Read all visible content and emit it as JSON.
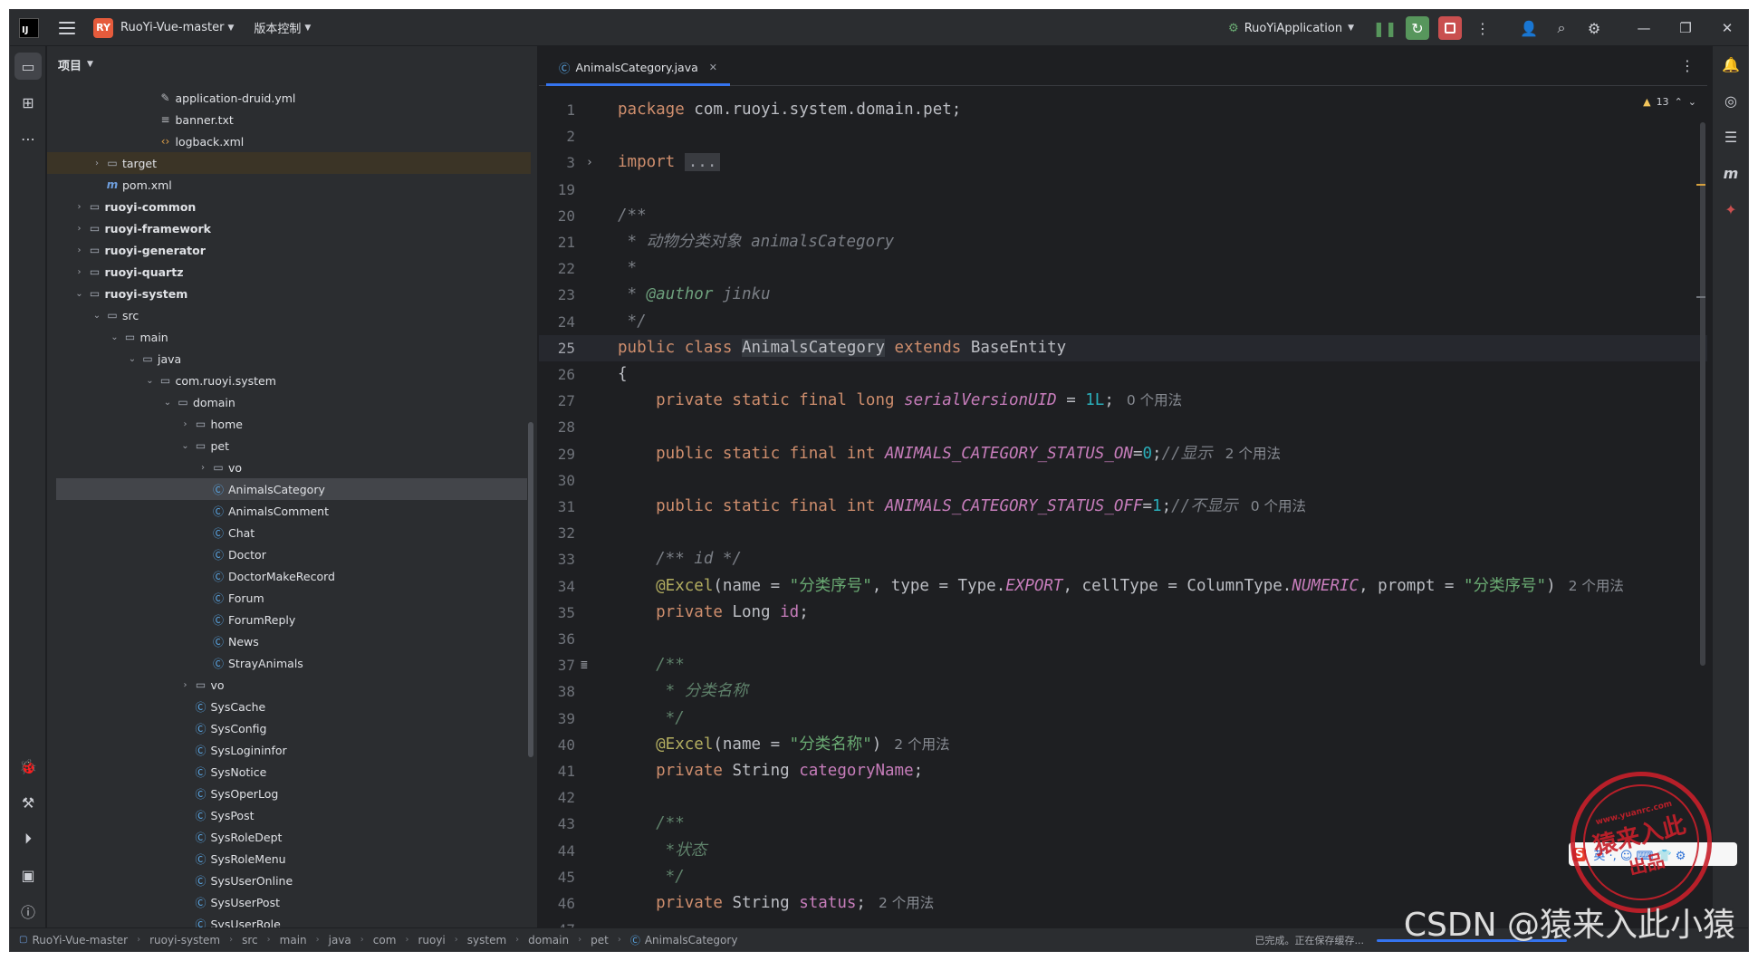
{
  "titlebar": {
    "project_badge": "RY",
    "project_name": "RuoYi-Vue-master",
    "vcs_label": "版本控制",
    "run_config": "RuoYiApplication"
  },
  "project_panel": {
    "title": "项目",
    "tree": [
      {
        "depth": 6,
        "icon": "yml-file-icon",
        "label": "application-druid.yml",
        "arrow": ""
      },
      {
        "depth": 6,
        "icon": "text-file-icon",
        "label": "banner.txt",
        "arrow": ""
      },
      {
        "depth": 6,
        "icon": "xml-file-icon",
        "label": "logback.xml",
        "arrow": ""
      },
      {
        "depth": 3,
        "icon": "folder-icon",
        "label": "target",
        "arrow": "collapsed",
        "highlight": true
      },
      {
        "depth": 3,
        "icon": "maven-icon",
        "label": "pom.xml",
        "arrow": ""
      },
      {
        "depth": 2,
        "icon": "module-folder-icon",
        "label": "ruoyi-common",
        "arrow": "collapsed",
        "bold": true
      },
      {
        "depth": 2,
        "icon": "module-folder-icon",
        "label": "ruoyi-framework",
        "arrow": "collapsed",
        "bold": true
      },
      {
        "depth": 2,
        "icon": "module-folder-icon",
        "label": "ruoyi-generator",
        "arrow": "collapsed",
        "bold": true
      },
      {
        "depth": 2,
        "icon": "module-folder-icon",
        "label": "ruoyi-quartz",
        "arrow": "collapsed",
        "bold": true
      },
      {
        "depth": 2,
        "icon": "module-folder-icon",
        "label": "ruoyi-system",
        "arrow": "expanded",
        "bold": true
      },
      {
        "depth": 3,
        "icon": "folder-icon",
        "label": "src",
        "arrow": "expanded"
      },
      {
        "depth": 4,
        "icon": "folder-icon",
        "label": "main",
        "arrow": "expanded"
      },
      {
        "depth": 5,
        "icon": "source-folder-icon",
        "label": "java",
        "arrow": "expanded"
      },
      {
        "depth": 6,
        "icon": "package-icon",
        "label": "com.ruoyi.system",
        "arrow": "expanded"
      },
      {
        "depth": 7,
        "icon": "package-icon",
        "label": "domain",
        "arrow": "expanded"
      },
      {
        "depth": 8,
        "icon": "package-icon",
        "label": "home",
        "arrow": "collapsed"
      },
      {
        "depth": 8,
        "icon": "package-icon",
        "label": "pet",
        "arrow": "expanded"
      },
      {
        "depth": 9,
        "icon": "package-icon",
        "label": "vo",
        "arrow": "collapsed"
      },
      {
        "depth": 9,
        "icon": "class-icon",
        "label": "AnimalsCategory",
        "arrow": "",
        "selected": true
      },
      {
        "depth": 9,
        "icon": "class-icon",
        "label": "AnimalsComment",
        "arrow": ""
      },
      {
        "depth": 9,
        "icon": "class-icon",
        "label": "Chat",
        "arrow": ""
      },
      {
        "depth": 9,
        "icon": "class-icon",
        "label": "Doctor",
        "arrow": ""
      },
      {
        "depth": 9,
        "icon": "class-icon",
        "label": "DoctorMakeRecord",
        "arrow": ""
      },
      {
        "depth": 9,
        "icon": "class-icon",
        "label": "Forum",
        "arrow": ""
      },
      {
        "depth": 9,
        "icon": "class-icon",
        "label": "ForumReply",
        "arrow": ""
      },
      {
        "depth": 9,
        "icon": "class-icon",
        "label": "News",
        "arrow": ""
      },
      {
        "depth": 9,
        "icon": "class-icon",
        "label": "StrayAnimals",
        "arrow": ""
      },
      {
        "depth": 8,
        "icon": "package-icon",
        "label": "vo",
        "arrow": "collapsed"
      },
      {
        "depth": 8,
        "icon": "class-icon",
        "label": "SysCache",
        "arrow": ""
      },
      {
        "depth": 8,
        "icon": "class-icon",
        "label": "SysConfig",
        "arrow": ""
      },
      {
        "depth": 8,
        "icon": "class-icon",
        "label": "SysLogininfor",
        "arrow": ""
      },
      {
        "depth": 8,
        "icon": "class-icon",
        "label": "SysNotice",
        "arrow": ""
      },
      {
        "depth": 8,
        "icon": "class-icon",
        "label": "SysOperLog",
        "arrow": ""
      },
      {
        "depth": 8,
        "icon": "class-icon",
        "label": "SysPost",
        "arrow": ""
      },
      {
        "depth": 8,
        "icon": "class-icon",
        "label": "SysRoleDept",
        "arrow": ""
      },
      {
        "depth": 8,
        "icon": "class-icon",
        "label": "SysRoleMenu",
        "arrow": ""
      },
      {
        "depth": 8,
        "icon": "class-icon",
        "label": "SysUserOnline",
        "arrow": ""
      },
      {
        "depth": 8,
        "icon": "class-icon",
        "label": "SysUserPost",
        "arrow": ""
      },
      {
        "depth": 8,
        "icon": "class-icon",
        "label": "SysUserRole",
        "arrow": ""
      }
    ]
  },
  "editor": {
    "tab_label": "AnimalsCategory.java",
    "warning_count": "13",
    "lines": [
      {
        "n": "1",
        "segs": [
          [
            "kw",
            "package "
          ],
          [
            "",
            "com.ruoyi.system.domain.pet;"
          ]
        ]
      },
      {
        "n": "2",
        "segs": []
      },
      {
        "n": "3",
        "fold": true,
        "segs": [
          [
            "kw",
            "import "
          ],
          [
            "fold",
            "..."
          ]
        ]
      },
      {
        "n": "19",
        "segs": []
      },
      {
        "n": "20",
        "segs": [
          [
            "cm",
            "/**"
          ]
        ]
      },
      {
        "n": "21",
        "segs": [
          [
            "cm",
            " * 动物分类对象 animalsCategory"
          ]
        ]
      },
      {
        "n": "22",
        "segs": [
          [
            "cm",
            " *"
          ]
        ]
      },
      {
        "n": "23",
        "segs": [
          [
            "cm",
            " * "
          ],
          [
            "cmtag",
            "@author"
          ],
          [
            "cm",
            " jinku"
          ]
        ]
      },
      {
        "n": "24",
        "segs": [
          [
            "cm",
            " */"
          ]
        ]
      },
      {
        "n": "25",
        "current": true,
        "segs": [
          [
            "kw",
            "public class "
          ],
          [
            "caretw",
            "AnimalsCategory"
          ],
          [
            "kw",
            " extends "
          ],
          [
            "",
            "BaseEntity"
          ]
        ]
      },
      {
        "n": "26",
        "segs": [
          [
            "",
            "{"
          ]
        ]
      },
      {
        "n": "27",
        "segs": [
          [
            "kw",
            "    private static final long "
          ],
          [
            "ifld",
            "serialVersionUID"
          ],
          [
            "",
            " = "
          ],
          [
            "num",
            "1L"
          ],
          [
            "",
            ";"
          ],
          [
            "hint",
            "0 个用法"
          ]
        ]
      },
      {
        "n": "28",
        "segs": []
      },
      {
        "n": "29",
        "segs": [
          [
            "kw",
            "    public static final int "
          ],
          [
            "ifld",
            "ANIMALS_CATEGORY_STATUS_ON"
          ],
          [
            "",
            "="
          ],
          [
            "num",
            "0"
          ],
          [
            "",
            ";"
          ],
          [
            "cm",
            "//显示"
          ],
          [
            "hint",
            "2 个用法"
          ]
        ]
      },
      {
        "n": "30",
        "segs": []
      },
      {
        "n": "31",
        "segs": [
          [
            "kw",
            "    public static final int "
          ],
          [
            "ifld",
            "ANIMALS_CATEGORY_STATUS_OFF"
          ],
          [
            "",
            "="
          ],
          [
            "num",
            "1"
          ],
          [
            "",
            ";"
          ],
          [
            "cm",
            "//不显示"
          ],
          [
            "hint",
            "0 个用法"
          ]
        ]
      },
      {
        "n": "32",
        "segs": []
      },
      {
        "n": "33",
        "segs": [
          [
            "cm",
            "    /** id */"
          ]
        ]
      },
      {
        "n": "34",
        "segs": [
          [
            "ann",
            "    @Excel"
          ],
          [
            "",
            "(name = "
          ],
          [
            "st",
            "\"分类序号\""
          ],
          [
            "",
            ", type = Type."
          ],
          [
            "ifld",
            "EXPORT"
          ],
          [
            "",
            ", cellType = ColumnType."
          ],
          [
            "ifld",
            "NUMERIC"
          ],
          [
            "",
            ", prompt = "
          ],
          [
            "st",
            "\"分类序号\""
          ],
          [
            "",
            ")"
          ],
          [
            "hint",
            "2 个用法"
          ]
        ]
      },
      {
        "n": "35",
        "segs": [
          [
            "kw",
            "    private "
          ],
          [
            "",
            "Long "
          ],
          [
            "fld",
            "id"
          ],
          [
            "",
            ";"
          ]
        ]
      },
      {
        "n": "36",
        "segs": []
      },
      {
        "n": "37",
        "doc": true,
        "segs": [
          [
            "cmz",
            "    /**"
          ]
        ]
      },
      {
        "n": "38",
        "segs": [
          [
            "cmz",
            "     * 分类名称"
          ]
        ]
      },
      {
        "n": "39",
        "segs": [
          [
            "cmz",
            "     */"
          ]
        ]
      },
      {
        "n": "40",
        "segs": [
          [
            "ann",
            "    @Excel"
          ],
          [
            "",
            "(name = "
          ],
          [
            "st",
            "\"分类名称\""
          ],
          [
            "",
            ")"
          ],
          [
            "hint",
            "2 个用法"
          ]
        ]
      },
      {
        "n": "41",
        "segs": [
          [
            "kw",
            "    private "
          ],
          [
            "",
            "String "
          ],
          [
            "fld",
            "categoryName"
          ],
          [
            "",
            ";"
          ]
        ]
      },
      {
        "n": "42",
        "segs": []
      },
      {
        "n": "43",
        "segs": [
          [
            "cmz",
            "    /**"
          ]
        ]
      },
      {
        "n": "44",
        "segs": [
          [
            "cmz",
            "     *状态"
          ]
        ]
      },
      {
        "n": "45",
        "segs": [
          [
            "cmz",
            "     */"
          ]
        ]
      },
      {
        "n": "46",
        "segs": [
          [
            "kw",
            "    private "
          ],
          [
            "",
            "String "
          ],
          [
            "fld",
            "status"
          ],
          [
            "",
            ";"
          ],
          [
            "hint",
            "2 个用法"
          ]
        ]
      },
      {
        "n": "47",
        "segs": []
      }
    ]
  },
  "statusbar": {
    "breadcrumbs": [
      "RuoYi-Vue-master",
      "ruoyi-system",
      "src",
      "main",
      "java",
      "com",
      "ruoyi",
      "system",
      "domain",
      "pet",
      "AnimalsCategory"
    ],
    "saving_text": "已完成。正在保存缓存..."
  },
  "watermark": {
    "text": "CSDN @猿来入此小猿",
    "stamp_main": "猿来入此",
    "stamp_sub": "出品",
    "stamp_url": "www.yuanrc.com",
    "ime_badge": "S",
    "ime_text": "英 ·, ☺ ⌨ 👕 ⚙"
  },
  "colors": {
    "accent": "#3574f0",
    "background": "#1e1f22",
    "panel": "#2b2d30",
    "run_green": "#57965c",
    "stop_red": "#c94f4f"
  }
}
